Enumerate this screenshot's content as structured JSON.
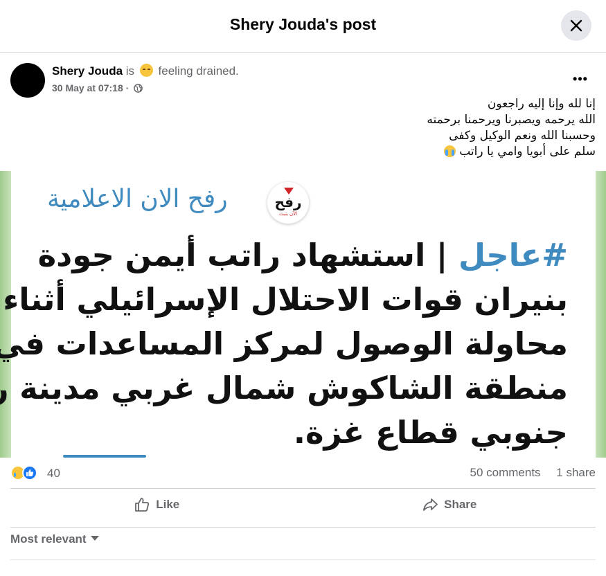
{
  "dialog": {
    "title": "Shery Jouda's post",
    "close_icon": "close-icon"
  },
  "post": {
    "author": "Shery Jouda",
    "is_text": "is",
    "feeling_emoji": "pensive-face-emoji",
    "feeling": "feeling drained.",
    "timestamp": "30 May at 07:18",
    "separator": "·",
    "audience_icon": "globe-icon",
    "more_label": "•••",
    "text_lines": [
      "إنا لله وإنا إليه راجعون",
      "الله يرحمه ويصبرنا ويرحمنا برحمته",
      "وحسبنا الله ونعم الوكيل وكفى",
      "سلم على أبويا وامي يا راتب"
    ]
  },
  "image": {
    "brand_name": "رفح الان الاعلامية",
    "logo_text": "رفح",
    "logo_sub": "الآن بثبث",
    "headline_tag": "#عاجل",
    "headline_lines": [
      "استشهاد راتب أيمن جودة",
      "بنيران قوات الاحتلال الإسرائيلي أثناء",
      "محاولة الوصول لمركز المساعدات في",
      "منطقة الشاكوش شمال غربي مدينة رفح",
      "جنوبي قطاع غزة."
    ],
    "colors": {
      "accent": "#3f8bbf",
      "logo_red": "#d0262b"
    }
  },
  "stats": {
    "reaction_count": "40",
    "comments": "50 comments",
    "shares": "1 share"
  },
  "actions": {
    "like_label": "Like",
    "share_label": "Share"
  },
  "comments": {
    "sort_label": "Most relevant"
  }
}
